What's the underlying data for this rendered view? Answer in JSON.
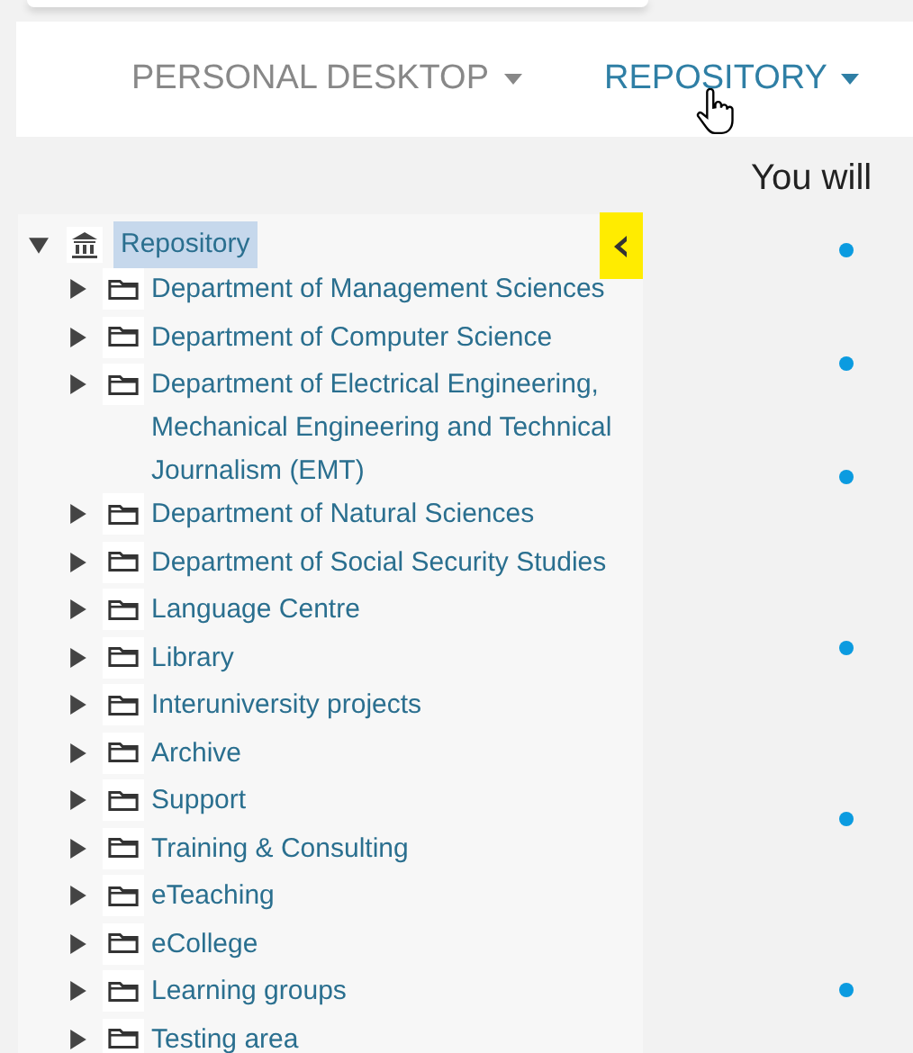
{
  "nav": {
    "items": [
      {
        "label": "PERSONAL DESKTOP",
        "selected": false
      },
      {
        "label": "REPOSITORY",
        "selected": true
      }
    ]
  },
  "content": {
    "intro": "You will"
  },
  "tree": {
    "root": {
      "label": "Repository",
      "expanded": true,
      "selected": true,
      "children": [
        {
          "label": "Department of Management Sciences",
          "expanded": false
        },
        {
          "label": "Department of Computer Science",
          "expanded": false
        },
        {
          "label": "Department of Electrical Engineering, Mechanical Engineering and Technical Journalism (EMT)",
          "expanded": false
        },
        {
          "label": "Department of Natural Sciences",
          "expanded": false
        },
        {
          "label": "Department of Social Security Studies",
          "expanded": false
        },
        {
          "label": "Language Centre",
          "expanded": false
        },
        {
          "label": "Library",
          "expanded": false
        },
        {
          "label": "Interuniversity projects",
          "expanded": false
        },
        {
          "label": "Archive",
          "expanded": false
        },
        {
          "label": "Support",
          "expanded": false
        },
        {
          "label": "Training & Consulting",
          "expanded": false
        },
        {
          "label": "eTeaching",
          "expanded": false
        },
        {
          "label": "eCollege",
          "expanded": false
        },
        {
          "label": "Learning groups",
          "expanded": false
        },
        {
          "label": "Testing area",
          "expanded": false
        }
      ]
    }
  }
}
